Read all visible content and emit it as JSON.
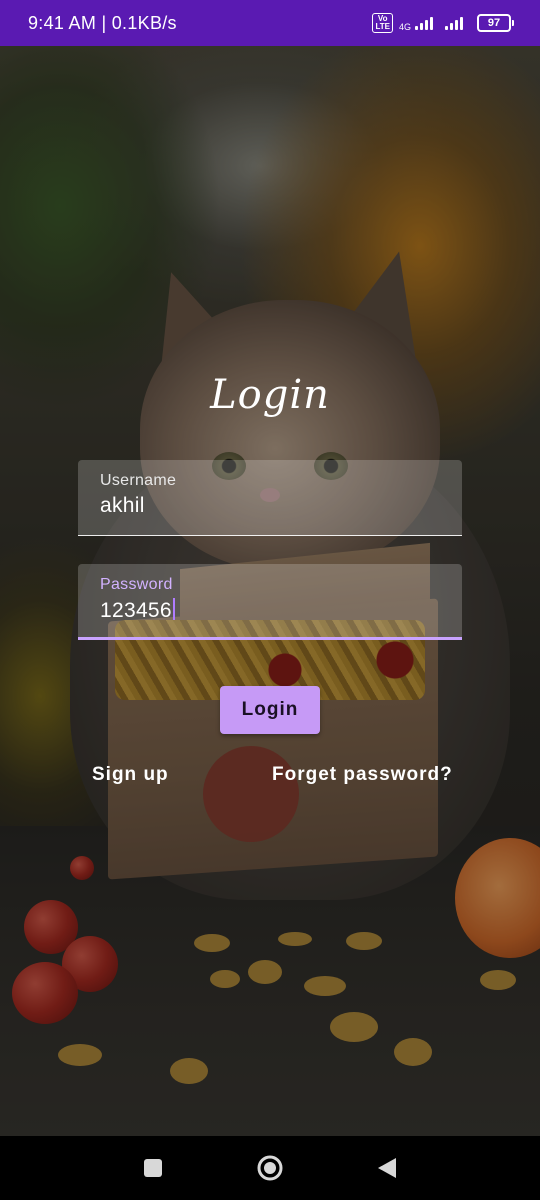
{
  "status_bar": {
    "time": "9:41 AM | 0.1KB/s",
    "volte_label": "Vo LTE",
    "network_label": "4G",
    "battery": "97",
    "color": "#5a1ab2"
  },
  "login": {
    "title": "Login",
    "username": {
      "label": "Username",
      "value": "akhil"
    },
    "password": {
      "label": "Password",
      "value": "123456"
    },
    "login_button": "Login",
    "signup_link": "Sign up",
    "forgot_link": "Forget password?"
  },
  "colors": {
    "accent": "#c69af6",
    "focused_label": "#d2b2ff",
    "focused_underline": "#c9a3ff",
    "nav_background": "#000000"
  },
  "icons": {
    "recents": "square-icon",
    "home": "circle-home-icon",
    "back": "triangle-back-icon"
  }
}
